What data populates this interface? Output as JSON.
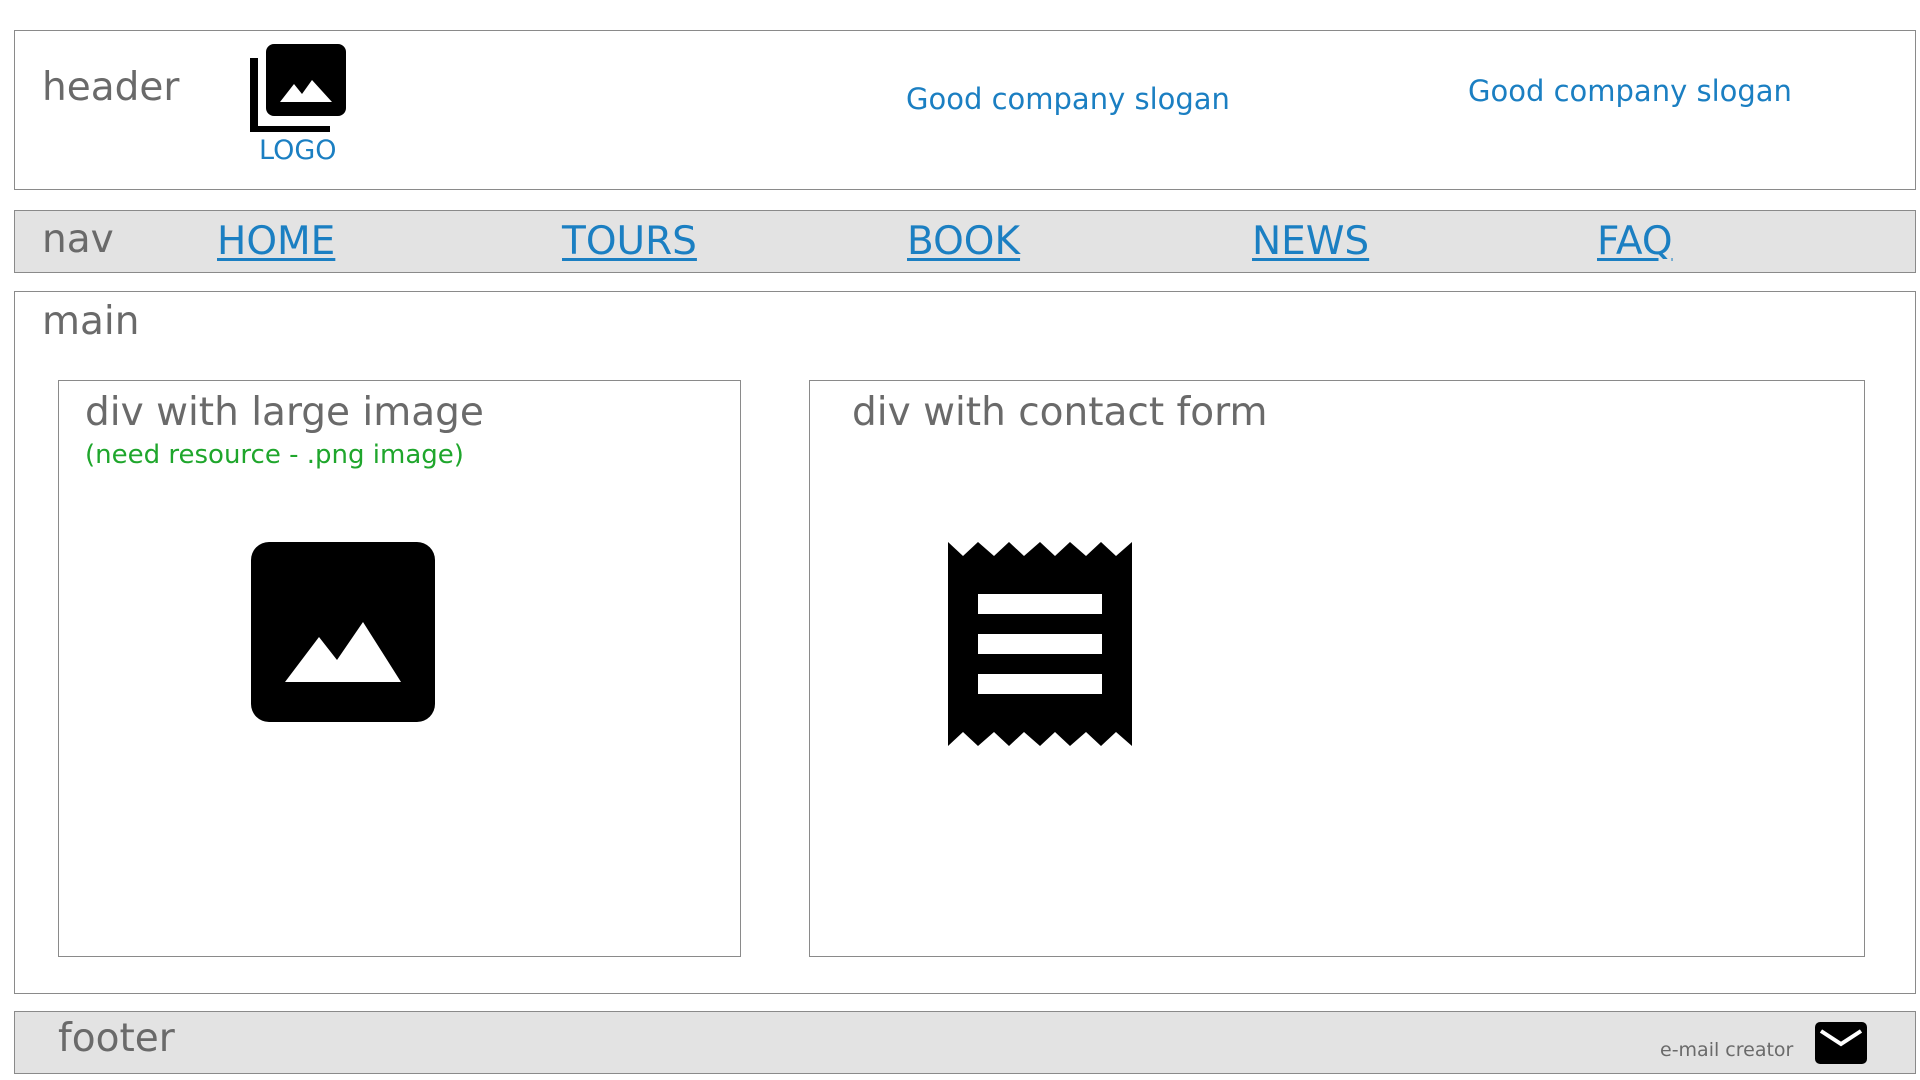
{
  "header": {
    "label": "header",
    "logo_text": "LOGO",
    "slogans": [
      "Good company slogan",
      "Good company slogan"
    ]
  },
  "nav": {
    "label": "nav",
    "items": [
      {
        "label": "HOME"
      },
      {
        "label": "TOURS"
      },
      {
        "label": "BOOK"
      },
      {
        "label": "NEWS"
      },
      {
        "label": "FAQ"
      }
    ]
  },
  "main": {
    "label": "main",
    "image_div": {
      "title": "div with large image",
      "note": "(need resource - .png image)",
      "icon": "image-icon"
    },
    "contact_div": {
      "title": "div with contact form",
      "icon": "receipt-icon"
    }
  },
  "footer": {
    "label": "footer",
    "email_text": "e-mail creator",
    "icon": "mail-icon"
  },
  "colors": {
    "link": "#1b7fc2",
    "note": "#1fa62c",
    "label": "#6a6a6a",
    "bar_bg": "#e3e3e3",
    "border": "#8a8a8a"
  }
}
